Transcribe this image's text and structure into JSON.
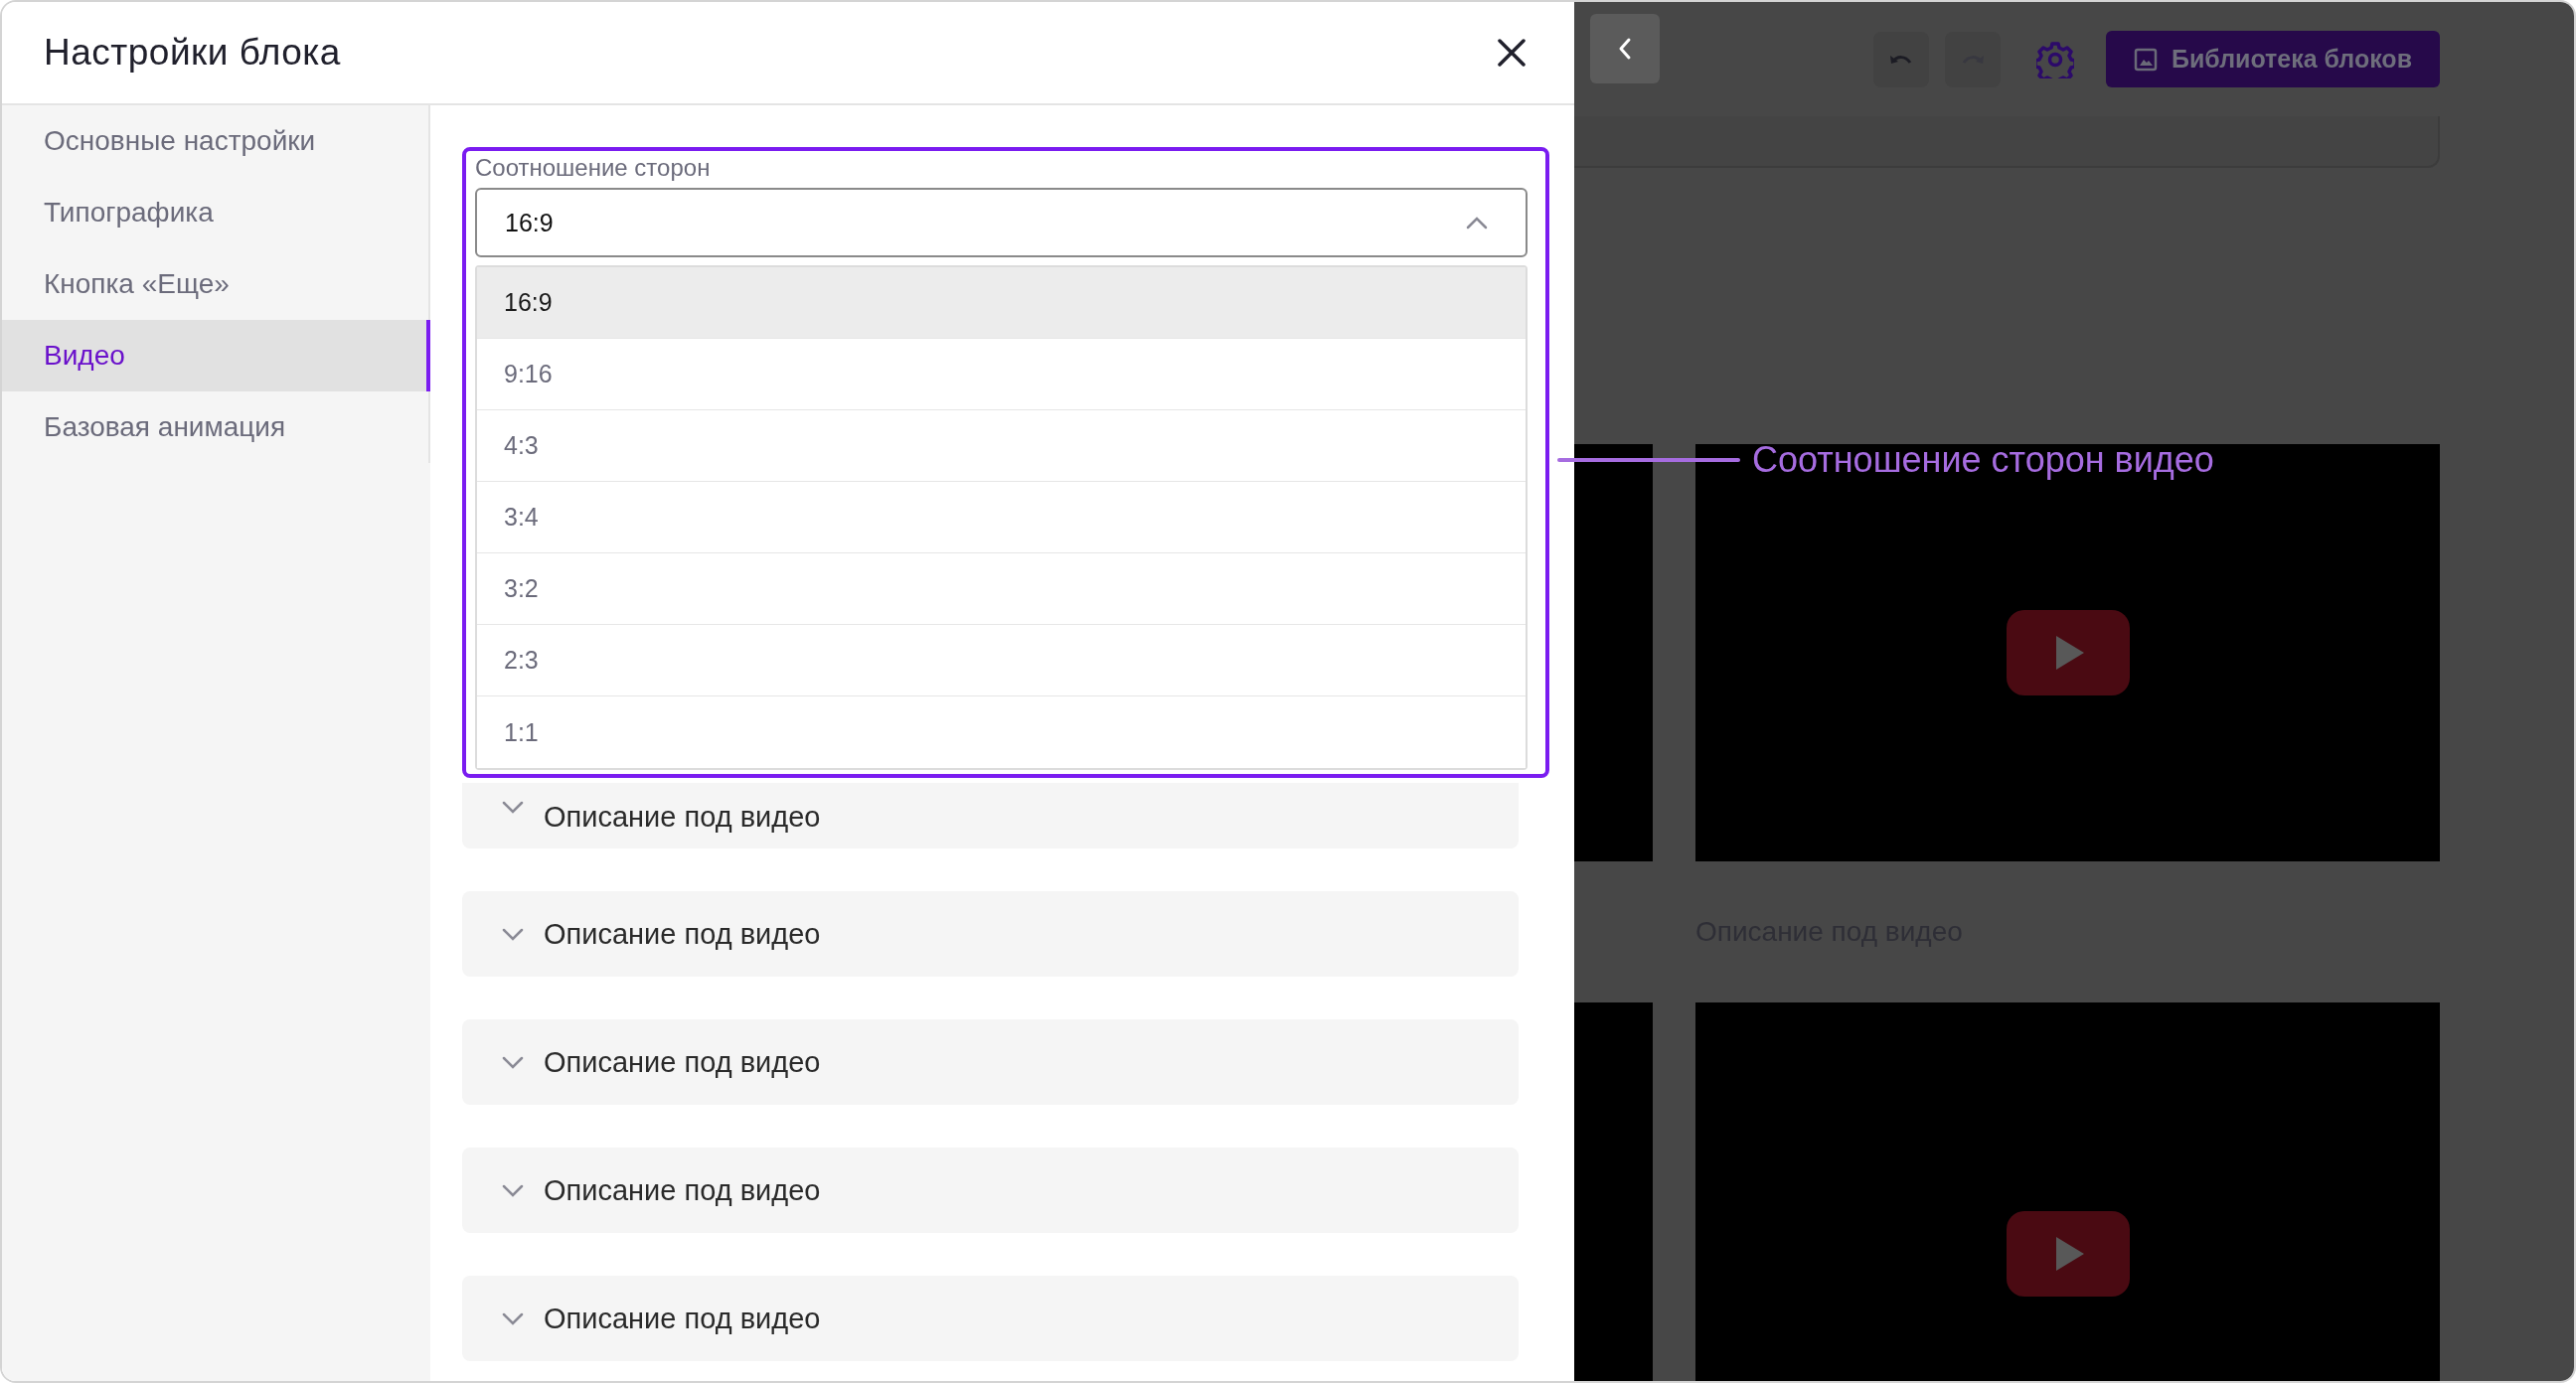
{
  "dialog": {
    "title": "Настройки блока"
  },
  "sidebar": {
    "items": [
      {
        "label": "Основные настройки",
        "selected": false
      },
      {
        "label": "Типографика",
        "selected": false
      },
      {
        "label": "Кнопка «Еще»",
        "selected": false
      },
      {
        "label": "Видео",
        "selected": true
      },
      {
        "label": "Базовая анимация",
        "selected": false
      }
    ]
  },
  "aspect_ratio": {
    "label": "Соотношение сторон",
    "value": "16:9",
    "expanded": true,
    "options": [
      {
        "label": "16:9",
        "selected": true
      },
      {
        "label": "9:16",
        "selected": false
      },
      {
        "label": "4:3",
        "selected": false
      },
      {
        "label": "3:4",
        "selected": false
      },
      {
        "label": "3:2",
        "selected": false
      },
      {
        "label": "2:3",
        "selected": false
      },
      {
        "label": "1:1",
        "selected": false
      }
    ]
  },
  "accordions": [
    {
      "label": "Описание под видео"
    },
    {
      "label": "Описание под видео"
    },
    {
      "label": "Описание под видео"
    },
    {
      "label": "Описание под видео"
    },
    {
      "label": "Описание под видео"
    }
  ],
  "editor": {
    "library_button": "Библиотека блоков",
    "caption": "Описание под видео"
  },
  "annotation": {
    "label": "Соотношение сторон видео"
  }
}
